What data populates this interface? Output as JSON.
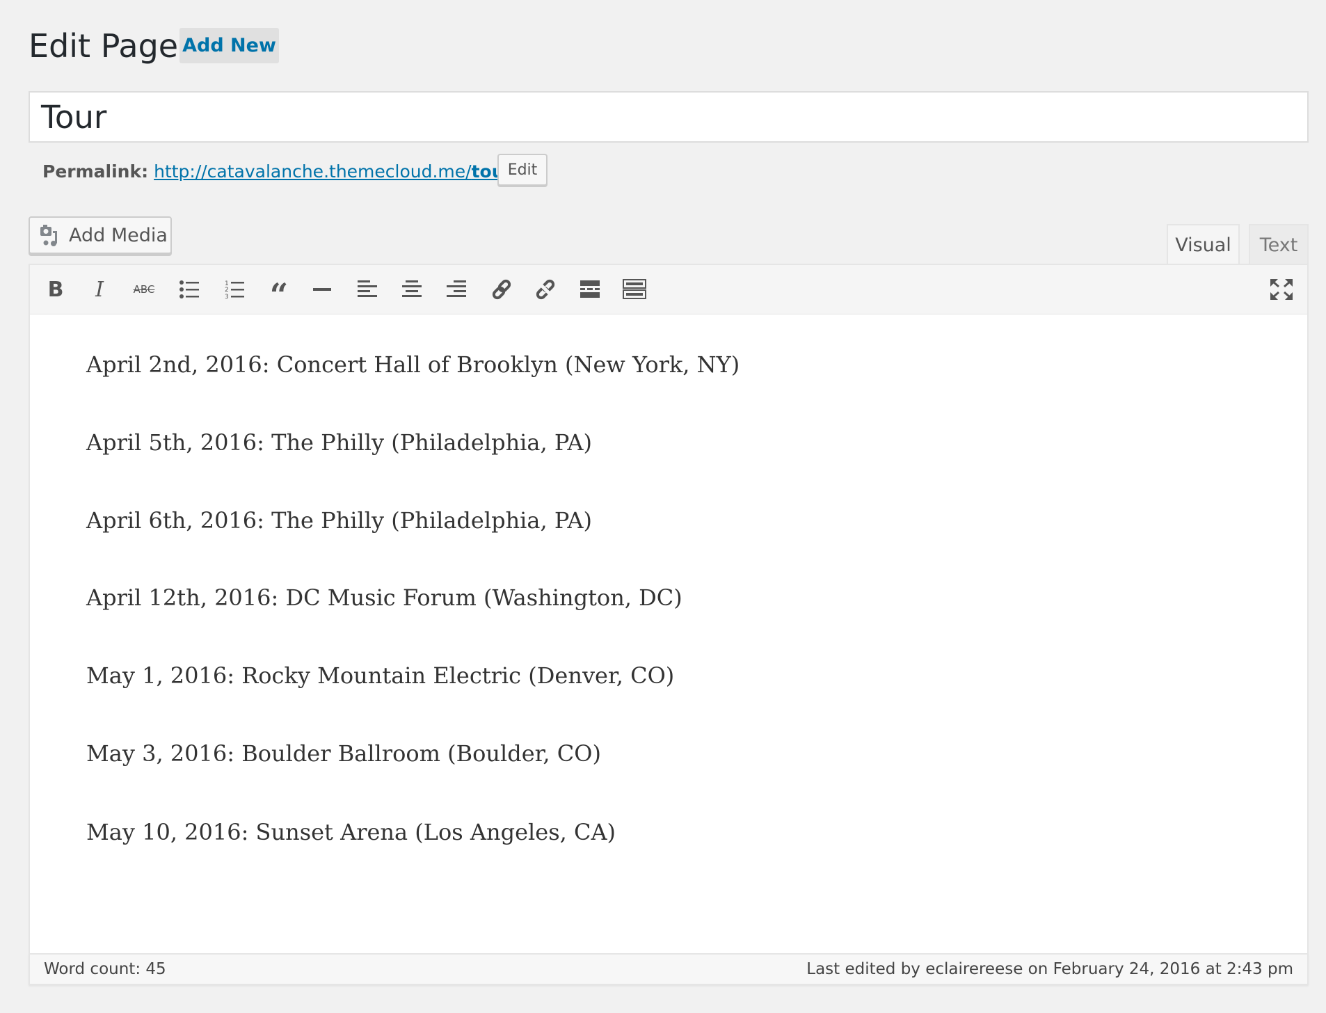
{
  "header": {
    "title": "Edit Page",
    "add_new": "Add New"
  },
  "post": {
    "title": "Tour",
    "permalink_label": "Permalink:",
    "permalink_base": "http://catavalanche.themecloud.me/",
    "permalink_slug": "tour",
    "permalink_trail": "/",
    "edit_label": "Edit"
  },
  "editor": {
    "add_media": "Add Media",
    "tabs": [
      {
        "label": "Visual",
        "active": true
      },
      {
        "label": "Text",
        "active": false
      }
    ],
    "toolbar": [
      "bold",
      "italic",
      "strikethrough",
      "bulleted-list",
      "numbered-list",
      "blockquote",
      "horizontal-line",
      "align-left",
      "align-center",
      "align-right",
      "insert-link",
      "remove-link",
      "read-more",
      "toolbar-toggle",
      "fullscreen"
    ],
    "lines": [
      "April 2nd, 2016: Concert Hall of Brooklyn (New York, NY)",
      "April 5th, 2016: The Philly (Philadelphia, PA)",
      "April 6th, 2016: The Philly (Philadelphia, PA)",
      "April 12th, 2016: DC Music Forum (Washington, DC)",
      "May 1, 2016: Rocky Mountain Electric (Denver, CO)",
      "May 3, 2016: Boulder Ballroom (Boulder, CO)",
      "May 10, 2016: Sunset Arena (Los Angeles, CA)"
    ],
    "word_count": "Word count: 45",
    "last_edited": "Last edited by eclairereese on February 24, 2016 at 2:43 pm"
  },
  "colors": {
    "link": "#0073aa",
    "background": "#f1f1f1"
  }
}
